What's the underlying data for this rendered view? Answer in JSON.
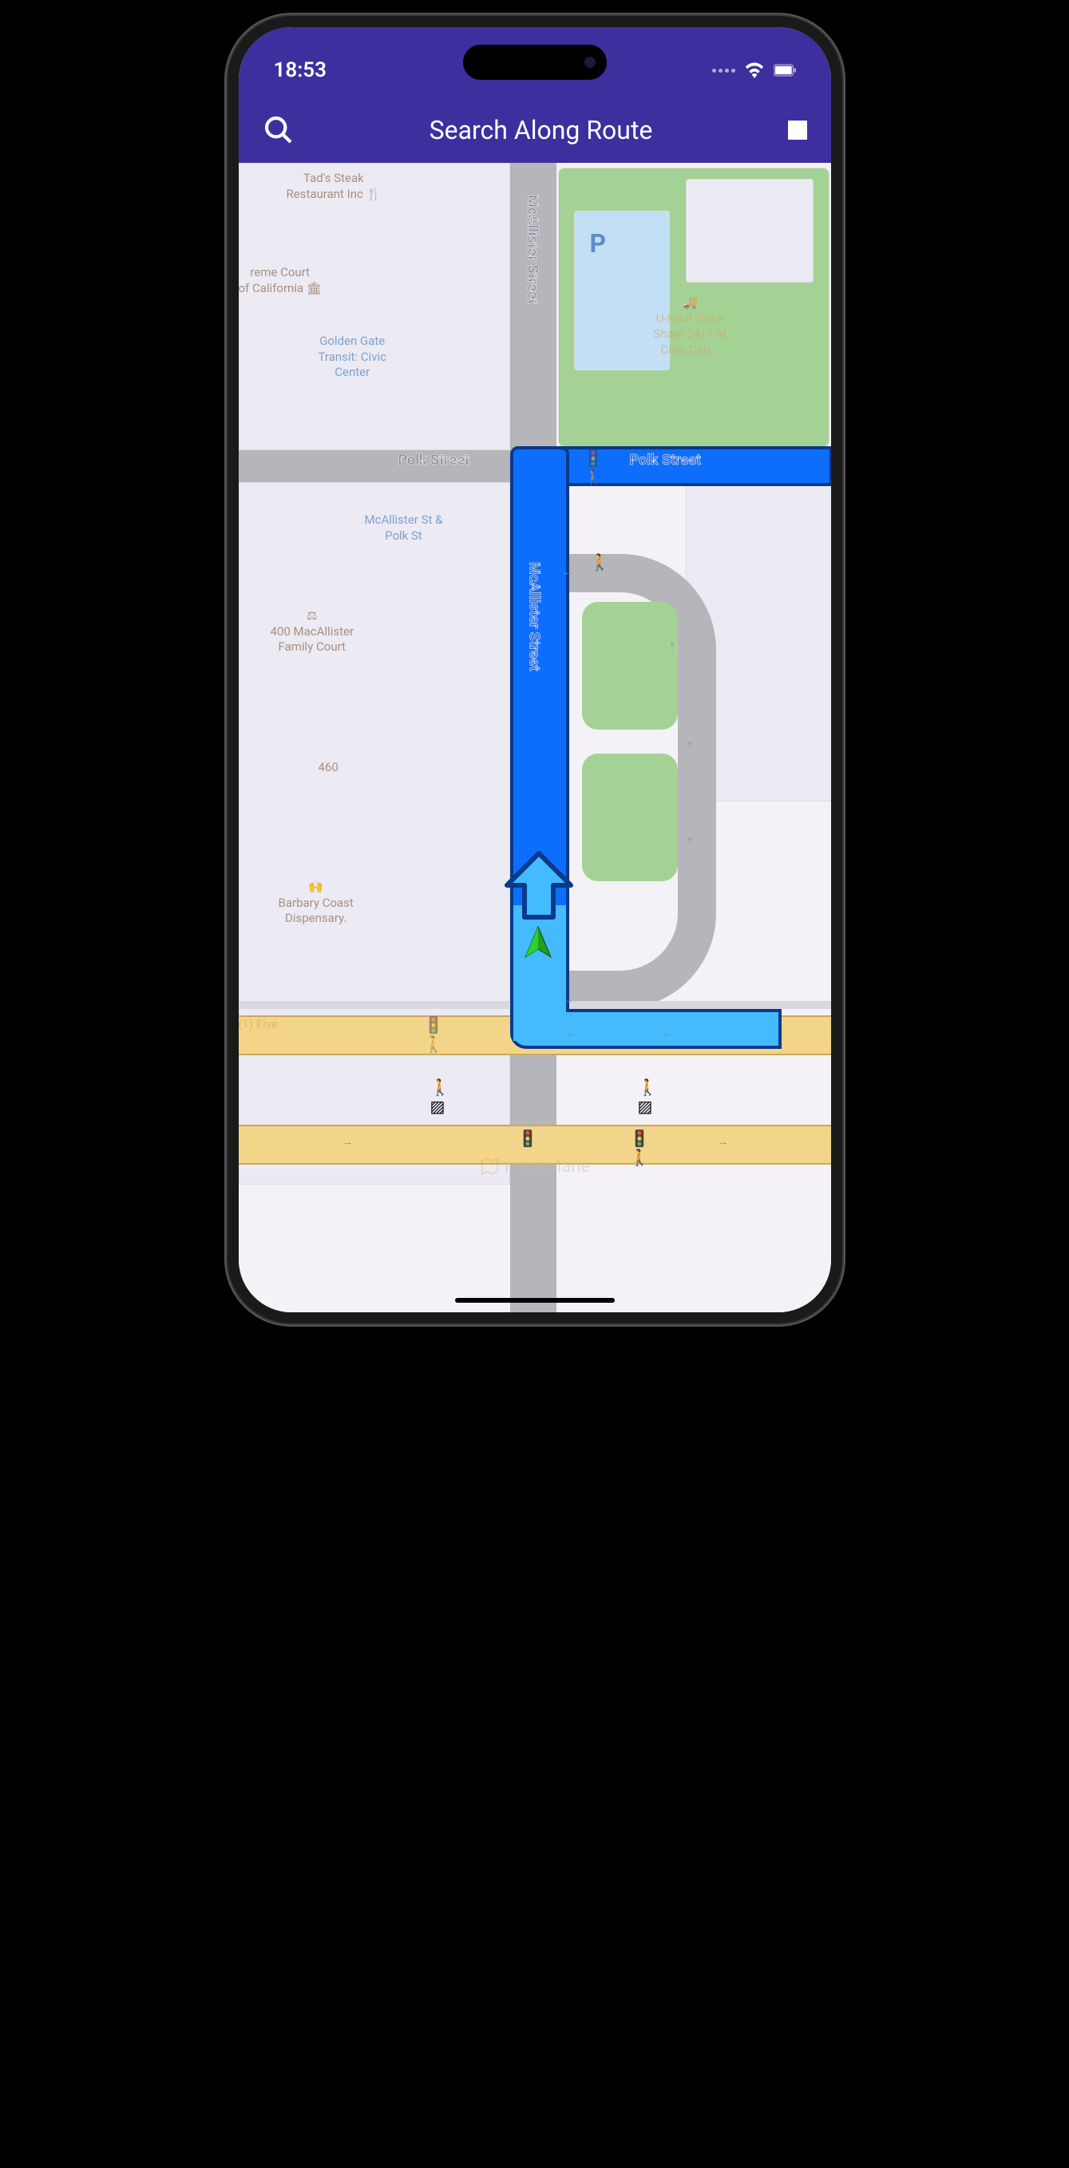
{
  "status": {
    "time": "18:53"
  },
  "header": {
    "title": "Search Along Route"
  },
  "map": {
    "streets": {
      "polk_left": "Polk Street",
      "polk_right": "Polk Street",
      "mcallister_top": "McAllister Street",
      "mcallister_route": "McAllister Street"
    },
    "pois": {
      "tads": "Tad's Steak\nRestaurant Inc",
      "supreme": "reme Court\nof California",
      "golden_gate": "Golden Gate\nTransit: Civic\nCenter",
      "mcallister_polk": "McAllister St &\nPolk St",
      "family_court": "400 MacAllister\nFamily Court",
      "addr_460": "460",
      "barbary": "Barbary Coast\nDispensary.",
      "uhaul": "U-Haul Truck\nShare 24/7 At\nCivic Cen...",
      "five": "(1) Five",
      "parking": "P"
    },
    "watermark": "magic lane"
  }
}
